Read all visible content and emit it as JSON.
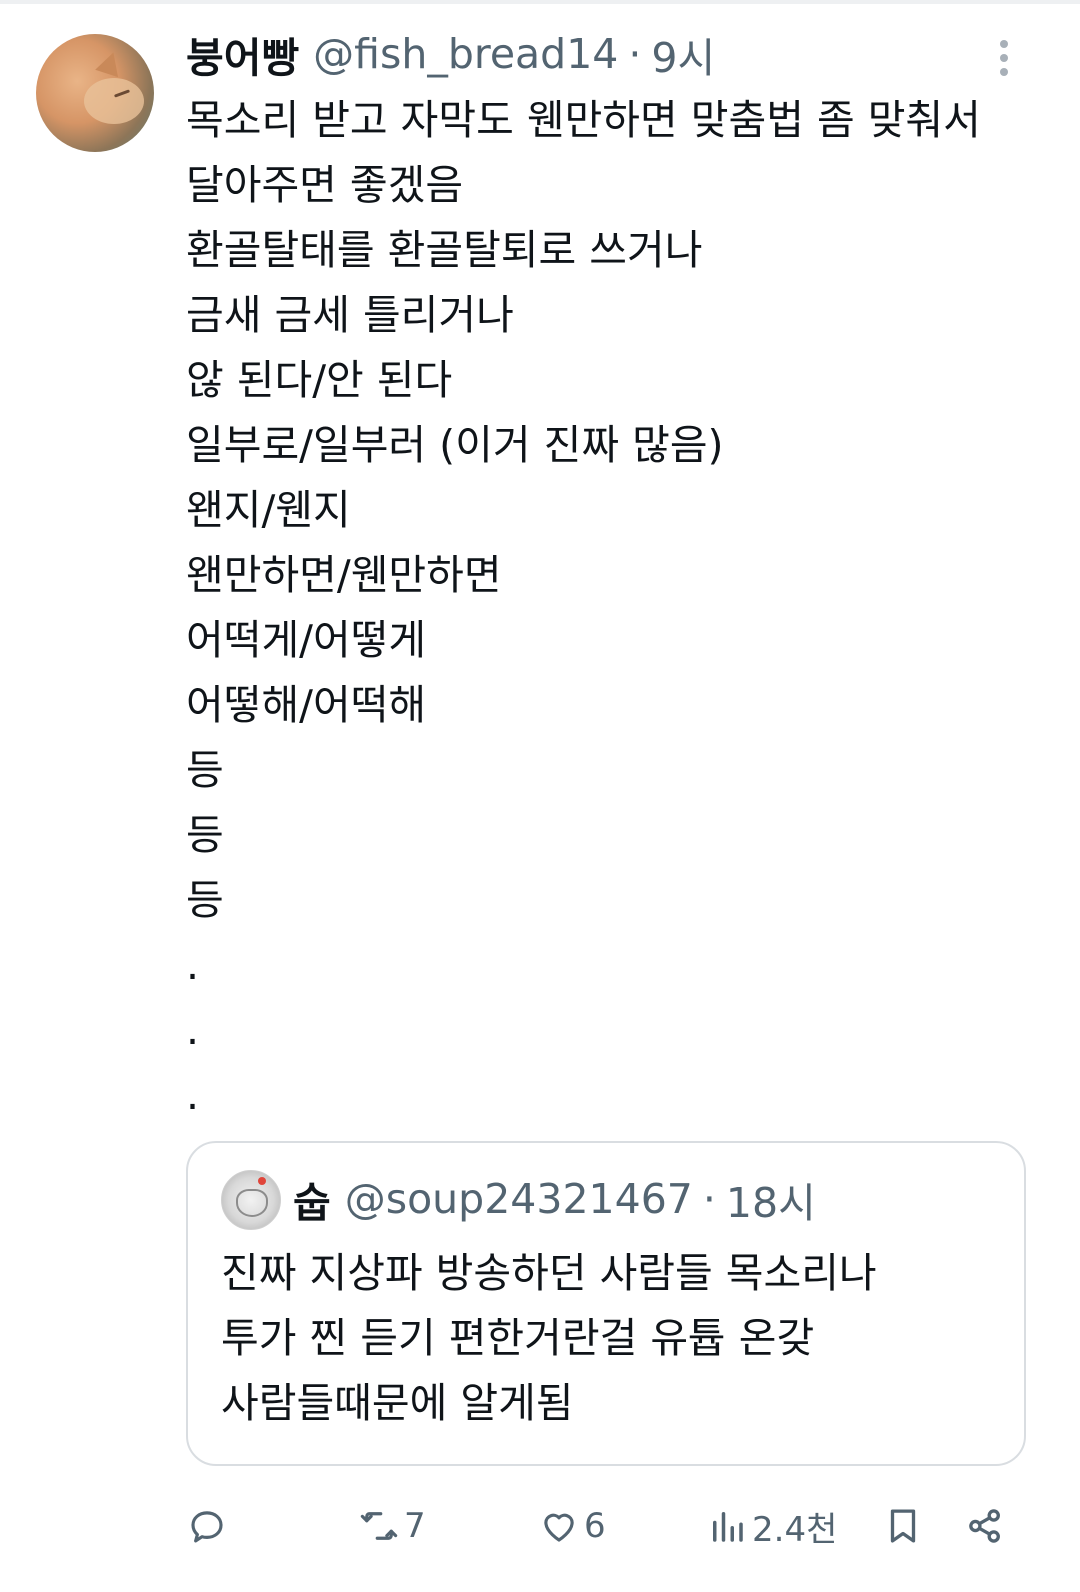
{
  "tweet": {
    "author_name": "붕어빵",
    "handle": "@fish_bread14",
    "separator": "·",
    "time": "9시",
    "lines": [
      "목소리 받고 자막도 웬만하면 맞춤법 좀 맞춰서",
      "달아주면 좋겠음",
      "환골탈태를 환골탈퇴로 쓰거나",
      "금새 금세 틀리거나",
      "않 된다/안 된다",
      "일부로/일부러 (이거 진짜 많음)",
      "왠지/웬지",
      "왠만하면/웬만하면",
      "어떡게/어떻게",
      "어떻해/어떡해",
      "등",
      "등",
      "등",
      ".",
      ".",
      "."
    ]
  },
  "quoted": {
    "author_name": "숩",
    "handle": "@soup24321467",
    "separator": "·",
    "time": "18시",
    "lines": [
      "진짜 지상파 방송하던 사람들 목소리나",
      "투가 찐 듣기 편한거란걸 유튭 온갖",
      "사람들때문에 알게됨"
    ]
  },
  "actions": {
    "reply_icon": "reply-icon",
    "retweet_count": "7",
    "like_count": "6",
    "views_count": "2.4천",
    "bookmark_icon": "bookmark-icon",
    "share_icon": "share-icon"
  },
  "colors": {
    "text": "#0f1419",
    "secondary": "#536471",
    "border": "#d9dde1",
    "icon": "#536471"
  }
}
